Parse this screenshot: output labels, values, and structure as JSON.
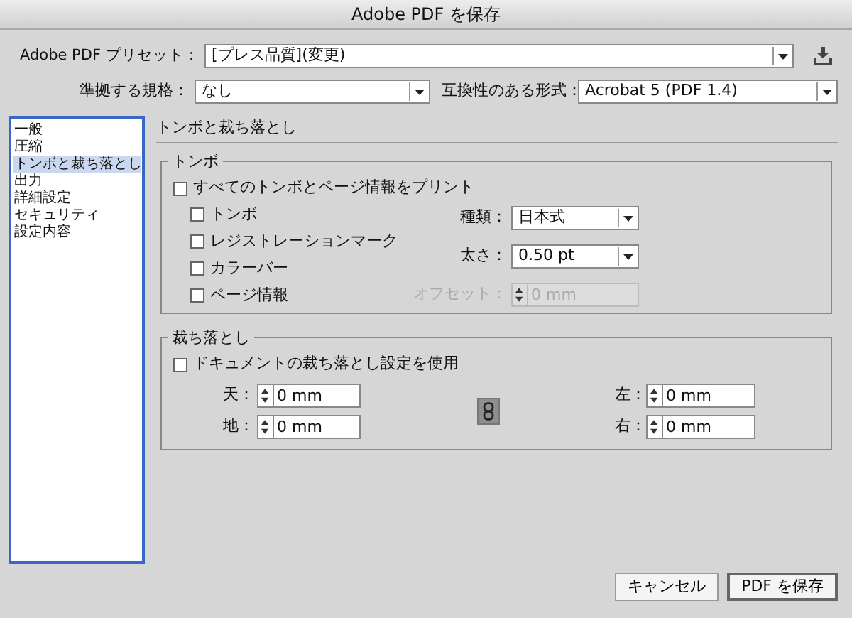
{
  "window": {
    "title": "Adobe PDF を保存"
  },
  "preset": {
    "label": "Adobe PDF プリセット：",
    "value": "[プレス品質](変更)"
  },
  "standard": {
    "label": "準拠する規格：",
    "value": "なし"
  },
  "compatibility": {
    "label": "互換性のある形式：",
    "value": "Acrobat 5 (PDF 1.4)"
  },
  "sidebar": {
    "items": [
      {
        "label": "一般",
        "selected": false
      },
      {
        "label": "圧縮",
        "selected": false
      },
      {
        "label": "トンボと裁ち落とし",
        "selected": true
      },
      {
        "label": "出力",
        "selected": false
      },
      {
        "label": "詳細設定",
        "selected": false
      },
      {
        "label": "セキュリティ",
        "selected": false
      },
      {
        "label": "設定内容",
        "selected": false
      }
    ]
  },
  "section_title": "トンボと裁ち落とし",
  "marks": {
    "legend": "トンボ",
    "all_marks": {
      "label": "すべてのトンボとページ情報をプリント",
      "checked": false
    },
    "options": [
      {
        "label": "トンボ",
        "checked": false
      },
      {
        "label": "レジストレーションマーク",
        "checked": false
      },
      {
        "label": "カラーバー",
        "checked": false
      },
      {
        "label": "ページ情報",
        "checked": false
      }
    ],
    "type": {
      "label": "種類：",
      "value": "日本式"
    },
    "weight": {
      "label": "太さ：",
      "value": "0.50 pt"
    },
    "offset": {
      "label": "オフセット：",
      "value": "0 mm",
      "disabled": true
    }
  },
  "bleed": {
    "legend": "裁ち落とし",
    "use_document": {
      "label": "ドキュメントの裁ち落とし設定を使用",
      "checked": false
    },
    "fields": [
      {
        "label": "天：",
        "value": "0 mm"
      },
      {
        "label": "左：",
        "value": "0 mm"
      },
      {
        "label": "地：",
        "value": "0 mm"
      },
      {
        "label": "右：",
        "value": "0 mm"
      }
    ],
    "linked": true
  },
  "buttons": [
    {
      "label": "キャンセル",
      "default": false
    },
    {
      "label": "PDF を保存",
      "default": true
    }
  ]
}
